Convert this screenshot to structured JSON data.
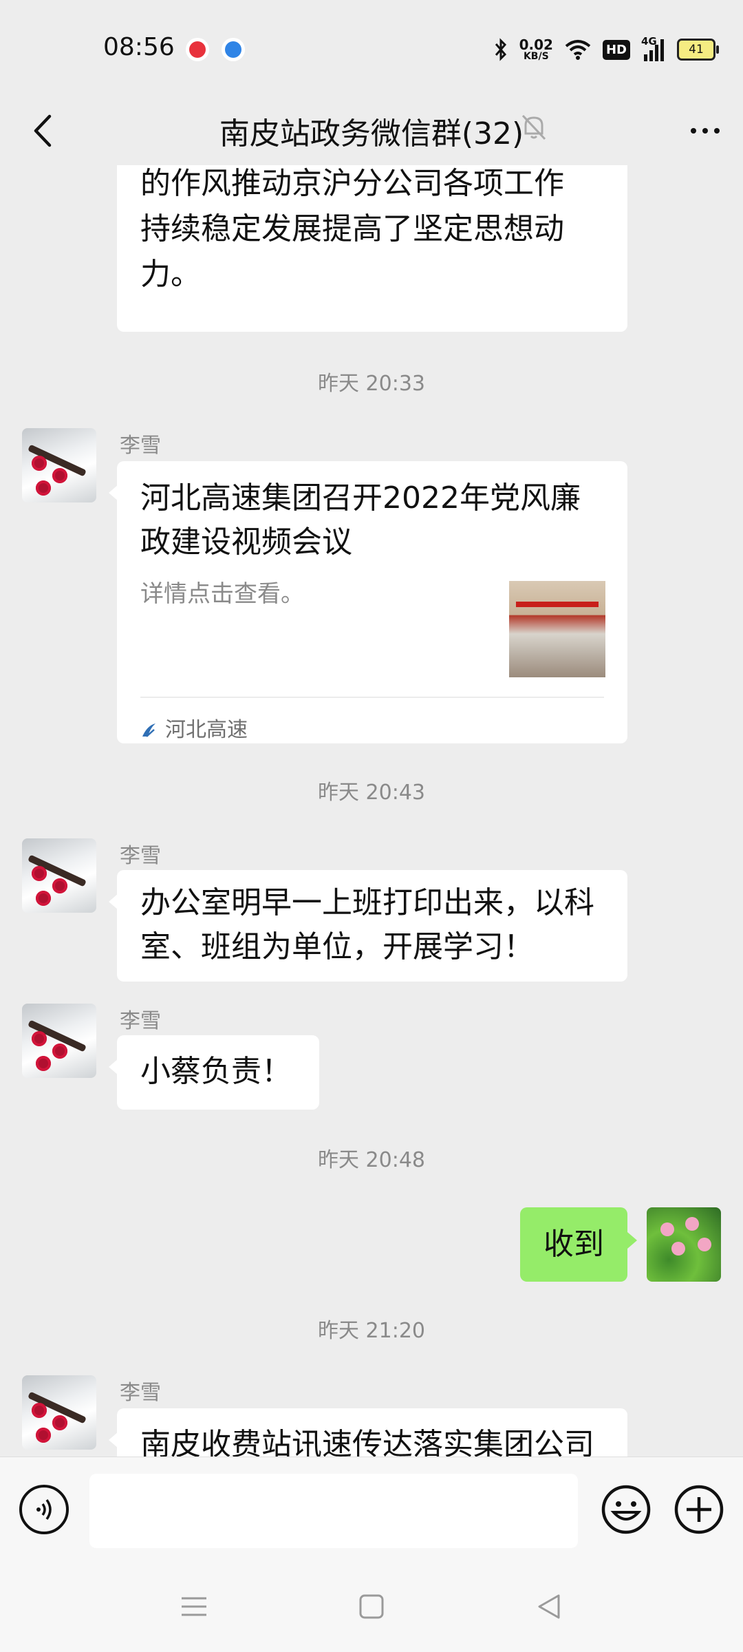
{
  "status": {
    "time": "08:56",
    "speed_value": "0.02",
    "speed_unit": "KB/S",
    "hd": "HD",
    "network": "4G",
    "battery": "41"
  },
  "header": {
    "title": "南皮站政务微信群(32)"
  },
  "messages": {
    "m0_lines": [
      "的作风推动京沪分公司各项工作",
      "持续稳定发展提高了坚定思想动",
      "力。"
    ],
    "ts1": "昨天 20:33",
    "m1_sender": "李雪",
    "m1_link_title": "河北高速集团召开2022年党风廉政建设视频会议",
    "m1_link_desc": "详情点击查看。",
    "m1_link_source": "河北高速",
    "ts2": "昨天 20:43",
    "m2_sender": "李雪",
    "m2_text": "办公室明早一上班打印出来，以科室、班组为单位，开展学习！",
    "m3_sender": "李雪",
    "m3_text": "小蔡负责！",
    "ts3": "昨天 20:48",
    "m4_text": "收到",
    "ts4": "昨天 21:20",
    "m5_sender": "李雪",
    "m5_text": "南皮收费站讯速传达落实集团公司"
  },
  "input": {
    "placeholder": ""
  },
  "icons": [
    "back-icon",
    "mute-bell-icon",
    "more-icon",
    "voice-icon",
    "emoji-icon",
    "plus-icon",
    "menu-icon",
    "home-icon",
    "back-triangle-icon"
  ],
  "colors": {
    "background": "#ededed",
    "my_bubble": "#95ec69",
    "other_bubble": "#ffffff"
  }
}
